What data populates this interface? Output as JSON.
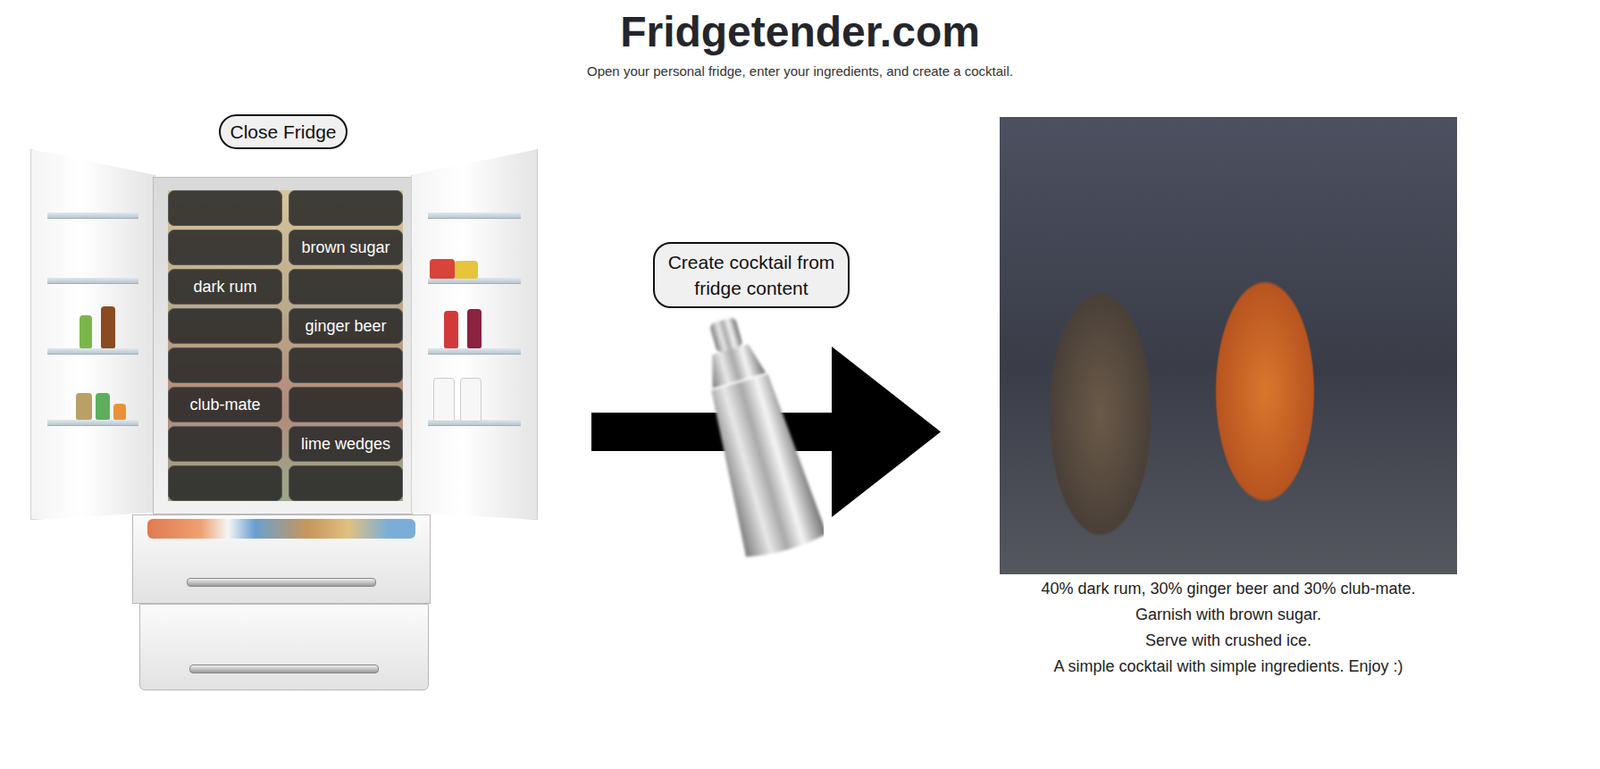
{
  "header": {
    "title": "Fridgetender.com",
    "subtitle": "Open your personal fridge, enter your ingredients, and create a cocktail."
  },
  "fridge": {
    "button": "Close Fridge",
    "open": true,
    "slots": [
      {
        "label": ""
      },
      {
        "label": ""
      },
      {
        "label": ""
      },
      {
        "label": "brown sugar"
      },
      {
        "label": "dark rum"
      },
      {
        "label": ""
      },
      {
        "label": ""
      },
      {
        "label": "ginger beer"
      },
      {
        "label": ""
      },
      {
        "label": ""
      },
      {
        "label": "club-mate"
      },
      {
        "label": ""
      },
      {
        "label": ""
      },
      {
        "label": "lime wedges"
      },
      {
        "label": ""
      },
      {
        "label": ""
      }
    ]
  },
  "create_button": "Create cocktail from fridge content",
  "recipe": {
    "lines": [
      "40% dark rum, 30% ginger beer and 30% club-mate.",
      "Garnish with brown sugar.",
      "Serve with crushed ice.",
      "A simple cocktail with simple ingredients. Enjoy :)"
    ]
  }
}
